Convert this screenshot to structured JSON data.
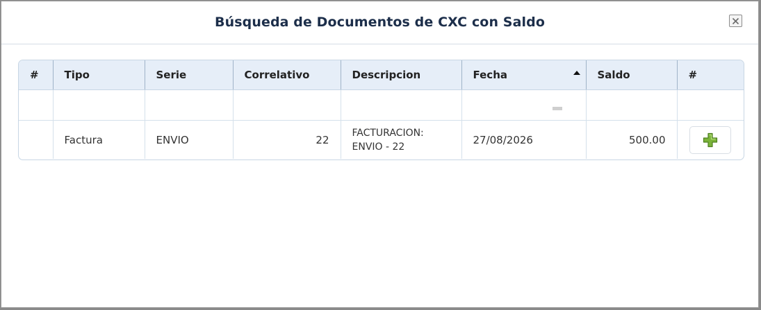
{
  "dialog": {
    "title": "Búsqueda de Documentos de CXC con Saldo"
  },
  "grid": {
    "columns": [
      "#",
      "Tipo",
      "Serie",
      "Correlativo",
      "Descripcion",
      "Fecha",
      "Saldo",
      "#"
    ],
    "sort_column": "Fecha",
    "sort_direction": "ascending",
    "rows": [
      {
        "index": "",
        "tipo": "Factura",
        "serie": "ENVIO",
        "correlativo": "22",
        "descripcion": "FACTURACION: ENVIO - 22",
        "fecha": "27/08/2026",
        "saldo": "500.00"
      }
    ]
  },
  "icons": {
    "close": "close-icon",
    "sort": "sort-ascending-icon",
    "add": "plus-icon"
  },
  "colors": {
    "title": "#1c2e4a",
    "header_bg": "#e6eef8",
    "add_icon": "#7bb33a"
  }
}
